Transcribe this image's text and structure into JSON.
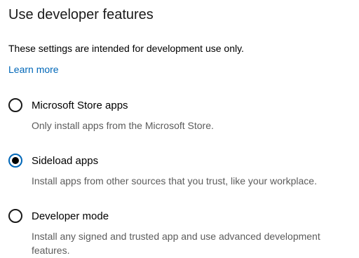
{
  "page": {
    "title": "Use developer features",
    "description": "These settings are intended for development use only.",
    "learn_more": "Learn more"
  },
  "options": [
    {
      "label": "Microsoft Store apps",
      "description": "Only install apps from the Microsoft Store.",
      "selected": false
    },
    {
      "label": "Sideload apps",
      "description": "Install apps from other sources that you trust, like your workplace.",
      "selected": true
    },
    {
      "label": "Developer mode",
      "description": "Install any signed and trusted app and use advanced development features.",
      "selected": false
    }
  ],
  "colors": {
    "accent": "#0067b8",
    "secondary_text": "#5c5c5c"
  }
}
